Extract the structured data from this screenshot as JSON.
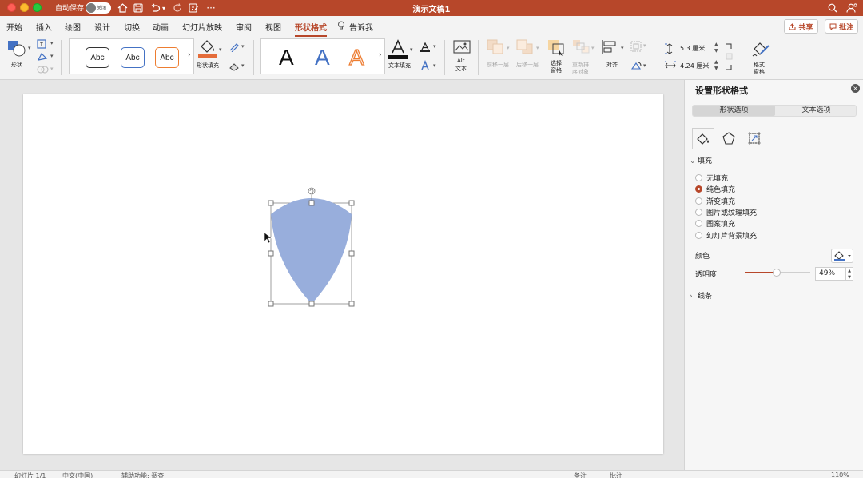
{
  "titlebar": {
    "autosave_label": "自动保存",
    "autosave_state": "关闭",
    "doc_title": "演示文稿1",
    "more": "···"
  },
  "tabs": [
    {
      "label": "开始"
    },
    {
      "label": "插入"
    },
    {
      "label": "绘图"
    },
    {
      "label": "设计"
    },
    {
      "label": "切换"
    },
    {
      "label": "动画"
    },
    {
      "label": "幻灯片放映"
    },
    {
      "label": "审阅"
    },
    {
      "label": "视图"
    },
    {
      "label": "形状格式"
    },
    {
      "label": "告诉我"
    }
  ],
  "active_tab": "形状格式",
  "header_buttons": {
    "share": "共享",
    "comment": "批注"
  },
  "ribbon": {
    "shapes_label": "形状",
    "style_samples": [
      "Abc",
      "Abc",
      "Abc"
    ],
    "shape_fill_label": "形状填充",
    "wordart_samples": [
      "A",
      "A",
      "A"
    ],
    "text_fill_label": "文本填充",
    "alt_text_label_1": "Alt",
    "alt_text_label_2": "文本",
    "bring_forward": "前移一层",
    "send_backward": "后移一层",
    "selection_pane_1": "选择",
    "selection_pane_2": "窗格",
    "reorder_1": "重新排",
    "reorder_2": "序对象",
    "align": "对齐",
    "height_value": "5.3 厘米",
    "width_value": "4.24 厘米",
    "format_pane_1": "格式",
    "format_pane_2": "窗格"
  },
  "panel": {
    "title": "设置形状格式",
    "seg_shape": "形状选项",
    "seg_text": "文本选项",
    "fill_section": "填充",
    "fill_options": [
      "无填充",
      "纯色填充",
      "渐变填充",
      "图片或纹理填充",
      "图案填充",
      "幻灯片背景填充"
    ],
    "fill_selected_index": 1,
    "color_label": "颜色",
    "transparency_label": "透明度",
    "transparency_value": "49%",
    "transparency_fraction": 0.49,
    "line_section": "线条"
  },
  "statusbar": {
    "slide_info": "幻灯片 1/1",
    "language": "中文(中国)",
    "accessibility": "辅助功能: 调查",
    "notes": "备注",
    "comments": "批注",
    "zoom": "110%"
  },
  "colors": {
    "accent": "#b7472a",
    "shape_fill": "#98aedc",
    "wordart_blue": "#4472c4",
    "wordart_orange": "#ed7d31"
  }
}
